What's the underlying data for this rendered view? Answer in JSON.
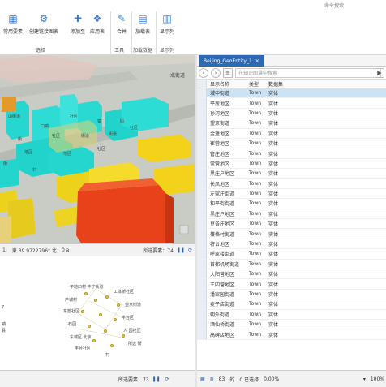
{
  "search": {
    "placeholder": "命令搜索"
  },
  "ribbon": {
    "buttons": [
      {
        "label": "常用要素",
        "icon": "layers-icon"
      },
      {
        "label": "创建链接图表",
        "icon": "chart-link-icon"
      },
      {
        "label": "添加至",
        "icon": "add-to-icon"
      },
      {
        "label": "应用表",
        "icon": "apply-table-icon"
      },
      {
        "label": "合并",
        "icon": "merge-icon"
      },
      {
        "label": "加载表",
        "icon": "load-table-icon"
      },
      {
        "label": "显示列",
        "icon": "show-columns-icon"
      }
    ],
    "groups": {
      "select": "选择",
      "tools": "工具",
      "load": "加载数据",
      "display": "显示列"
    }
  },
  "map": {
    "building_labels": [
      "山街道",
      "口镇",
      "社区",
      "镇",
      "街",
      "社区",
      "街道",
      "街",
      "社区",
      "地区",
      "地区",
      "社区",
      "街",
      "村",
      "街道"
    ],
    "north_label": "北街道"
  },
  "map_status": {
    "scale": "1:",
    "coords": "東 39.9722796° 北",
    "value": "0 a",
    "selected": "所选要素：74"
  },
  "graph": {
    "labels": [
      "平地口村 丰宁街道",
      "工体桥社区",
      "芦城村",
      "望京街道",
      "东部社区",
      "丰台区",
      "石园",
      "人 园社区",
      "东城区 北京",
      "所选 街",
      "丰台社区",
      "村"
    ],
    "side_labels": [
      "7",
      "镇",
      "县"
    ]
  },
  "lower_status": {
    "selected": "所选要素：73"
  },
  "table": {
    "tab_title": "Beijing_GeoEntity_1",
    "filter_placeholder": "在知识图谱中搜索",
    "headers": {
      "name": "显示名称",
      "type": "类型",
      "kind": "数据集"
    },
    "rows": [
      {
        "name": "城中街道",
        "type": "Town",
        "kind": "实体"
      },
      {
        "name": "平房地区",
        "type": "Town",
        "kind": "实体"
      },
      {
        "name": "孙河地区",
        "type": "Town",
        "kind": "实体"
      },
      {
        "name": "望京街道",
        "type": "Town",
        "kind": "实体"
      },
      {
        "name": "金盏地区",
        "type": "Town",
        "kind": "实体"
      },
      {
        "name": "崔营地区",
        "type": "Town",
        "kind": "实体"
      },
      {
        "name": "管庄地区",
        "type": "Town",
        "kind": "实体"
      },
      {
        "name": "常营地区",
        "type": "Town",
        "kind": "实体"
      },
      {
        "name": "黑庄户地区",
        "type": "Town",
        "kind": "实体"
      },
      {
        "name": "长凤地区",
        "type": "Town",
        "kind": "实体"
      },
      {
        "name": "左家庄街道",
        "type": "Town",
        "kind": "实体"
      },
      {
        "name": "和平街街道",
        "type": "Town",
        "kind": "实体"
      },
      {
        "name": "黑庄户地区",
        "type": "Town",
        "kind": "实体"
      },
      {
        "name": "豆各庄地区",
        "type": "Town",
        "kind": "实体"
      },
      {
        "name": "楼格村街道",
        "type": "Town",
        "kind": "实体"
      },
      {
        "name": "将台地区",
        "type": "Town",
        "kind": "实体"
      },
      {
        "name": "呼家楼街道",
        "type": "Town",
        "kind": "实体"
      },
      {
        "name": "首都机场街道",
        "type": "Town",
        "kind": "实体"
      },
      {
        "name": "大阳营地区",
        "type": "Town",
        "kind": "实体"
      },
      {
        "name": "王四营地区",
        "type": "Town",
        "kind": "实体"
      },
      {
        "name": "潘家园街道",
        "type": "Town",
        "kind": "实体"
      },
      {
        "name": "麦子店街道",
        "type": "Town",
        "kind": "实体"
      },
      {
        "name": "朝外街道",
        "type": "Town",
        "kind": "实体"
      },
      {
        "name": "酒仙桥街道",
        "type": "Town",
        "kind": "实体"
      },
      {
        "name": "高碑店地区",
        "type": "Town",
        "kind": "实体"
      }
    ],
    "status": {
      "count": "83",
      "of": "的",
      "selected": "0 已选择",
      "pct": "0.00%",
      "zoom": "100%"
    }
  }
}
